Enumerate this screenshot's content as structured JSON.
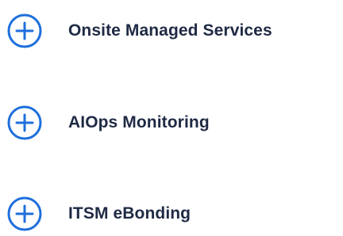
{
  "accordion": {
    "items": [
      {
        "label": "Onsite Managed Services",
        "icon": "plus-circle-icon"
      },
      {
        "label": "AIOps Monitoring",
        "icon": "plus-circle-icon"
      },
      {
        "label": "ITSM eBonding",
        "icon": "plus-circle-icon"
      }
    ]
  },
  "colors": {
    "icon": "#1e6fdc",
    "label": "#1f2a44",
    "background": "#ffffff"
  }
}
